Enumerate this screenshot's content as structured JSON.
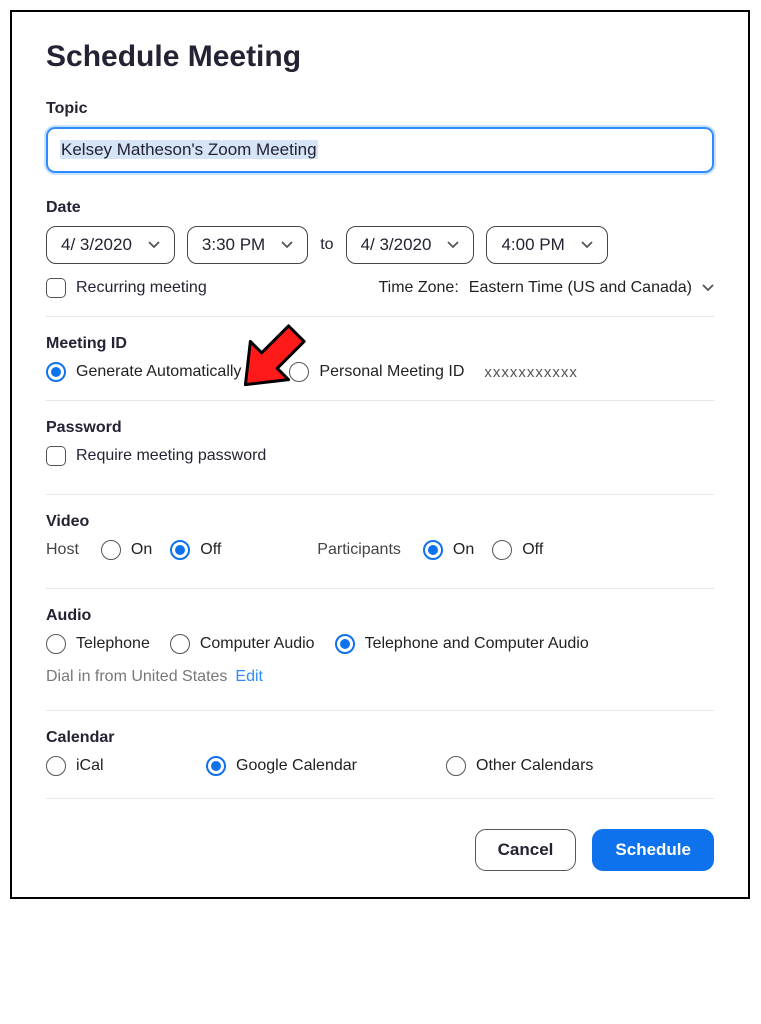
{
  "title": "Schedule Meeting",
  "topic": {
    "label": "Topic",
    "value": "Kelsey Matheson's Zoom Meeting"
  },
  "date": {
    "label": "Date",
    "start_date": "4/  3/2020",
    "start_time": "3:30 PM",
    "to": "to",
    "end_date": "4/  3/2020",
    "end_time": "4:00 PM",
    "recurring_label": "Recurring meeting",
    "recurring_checked": false,
    "tz_label": "Time Zone:",
    "tz_value": "Eastern Time (US and Canada)"
  },
  "meeting_id": {
    "label": "Meeting ID",
    "generate_label": "Generate Automatically",
    "personal_label": "Personal Meeting ID",
    "personal_id": "xxxxxxxxxxx",
    "selected": "generate"
  },
  "password": {
    "label": "Password",
    "require_label": "Require meeting password",
    "require_checked": false
  },
  "video": {
    "label": "Video",
    "host_label": "Host",
    "participants_label": "Participants",
    "on": "On",
    "off": "Off",
    "host_selected": "off",
    "participants_selected": "on"
  },
  "audio": {
    "label": "Audio",
    "telephone": "Telephone",
    "computer": "Computer Audio",
    "both": "Telephone and Computer Audio",
    "selected": "both",
    "dial_text": "Dial in from United States",
    "edit": "Edit"
  },
  "calendar": {
    "label": "Calendar",
    "ical": "iCal",
    "google": "Google Calendar",
    "other": "Other Calendars",
    "selected": "google"
  },
  "footer": {
    "cancel": "Cancel",
    "schedule": "Schedule"
  }
}
